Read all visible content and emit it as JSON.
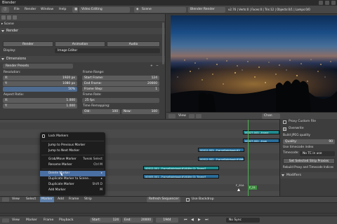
{
  "app": {
    "title": "Blender"
  },
  "header": {
    "menus": [
      "File",
      "Render",
      "Window",
      "Help"
    ],
    "screen_layout": "Video Editing",
    "scene": "Scene",
    "render_engine": "Blender Render",
    "stats": "v2.76 | Verts:0 | Faces:0 | Tris:12 | Objects:0/1 | Lamps:0/0"
  },
  "properties": {
    "context": "Scene",
    "render_panel": {
      "title": "Render",
      "buttons": [
        "Render",
        "Animation",
        "Audio"
      ],
      "display_label": "Display:",
      "display_value": "Image Editor"
    },
    "dimensions_panel": {
      "title": "Dimensions",
      "presets_label": "Render Presets",
      "resolution_label": "Resolution:",
      "res_x_label": "X:",
      "res_x": "1920 px",
      "res_y_label": "Y:",
      "res_y": "1080 px",
      "res_pct": "50%",
      "aspect_label": "Aspect Ratio:",
      "aspect_x_label": "X:",
      "aspect_x": "1.000",
      "aspect_y_label": "Y:",
      "aspect_y": "1.000",
      "frame_range_label": "Frame Range:",
      "start_label": "Start Frame:",
      "start": "124",
      "end_label": "End Frame:",
      "end": "20000",
      "step_label": "Frame Step:",
      "step": "1",
      "frame_rate_label": "Frame Rate:",
      "frame_rate": "25 fps",
      "remap_label": "Time Remapping:",
      "remap_old_label": "Old:",
      "remap_old": "100",
      "remap_new_label": "New:",
      "remap_new": "100"
    }
  },
  "preview": {
    "menus": [
      "View"
    ],
    "channel_label": "Chan"
  },
  "sequencer": {
    "strips": [
      {
        "label": "00027.003...frame",
        "color": "#1f8b8f"
      },
      {
        "label": "00027.002...fram",
        "color": "#2a6e9a"
      },
      {
        "label": "00012.003...FrameNotebook#V",
        "color": "#2a6e9a"
      },
      {
        "label": "00012.002...FrameNotebook#VAfter D: Trame?",
        "color": "#2a6e9a"
      },
      {
        "label": "00012.001...FrameNotebook#V#Afer D: Trame?",
        "color": "#1f8b8f"
      },
      {
        "label": "00005.001...FrameNotebook#V#Afer D: Trame?",
        "color": "#2a6e9a"
      }
    ],
    "marker_label": "F_01A",
    "playhead_label": "F_21"
  },
  "context_menu": {
    "title": "Lock Markers",
    "items": [
      {
        "label": "Jump to Previous Marker",
        "shortcut": ""
      },
      {
        "label": "Jump to Next Marker",
        "shortcut": ""
      },
      {
        "label": "Grab/Move Marker",
        "shortcut": "Tweak Select"
      },
      {
        "label": "Rename Marker",
        "shortcut": "Ctrl M"
      },
      {
        "label": "Delete Marker",
        "shortcut": ""
      },
      {
        "label": "Duplicate Marker to Scene...",
        "shortcut": ""
      },
      {
        "label": "Duplicate Marker",
        "shortcut": "Shift D"
      },
      {
        "label": "Add Marker",
        "shortcut": "M"
      }
    ]
  },
  "side_panel": {
    "proxy_label": "Proxy Custom File",
    "overwrite_label": "Overwrite",
    "build_label": "Build JPEG quality",
    "quality_label": "Quality:",
    "quality": "90",
    "timecode_label": "Use timecode index",
    "timecode_value": "No TC in use",
    "timecode_field_label": "Timecode:",
    "set_button": "Set Selected Strip Proxies",
    "rebuild_label": "Rebuild Proxy and Timecode Indices",
    "modifiers_label": "Modifiers"
  },
  "sequencer_footer": {
    "menus": [
      "View",
      "Select",
      "Marker",
      "Add",
      "Frame",
      "Strip"
    ],
    "refresh_button": "Refresh Sequencer",
    "backdrop_label": "Use Backdrop"
  },
  "playback": {
    "menus": [
      "View",
      "Marker",
      "Frame",
      "Playback"
    ],
    "start_label": "Start:",
    "start": "124",
    "end_label": "End:",
    "end": "20000",
    "current": "1944",
    "sync": "No Sync"
  }
}
